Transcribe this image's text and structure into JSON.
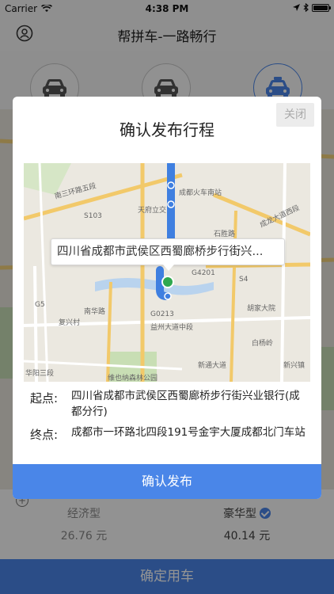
{
  "status_bar": {
    "carrier": "Carrier",
    "time": "4:38 PM"
  },
  "nav": {
    "title": "帮拼车-一路畅行"
  },
  "car_types": [
    {
      "icon": "car-icon",
      "selected": false
    },
    {
      "icon": "car-icon",
      "selected": false
    },
    {
      "icon": "taxi-icon",
      "selected": true
    }
  ],
  "estimate": {
    "options": [
      {
        "name": "经济型",
        "price": "26.76 元",
        "selected": false
      },
      {
        "name": "豪华型",
        "price": "40.14 元",
        "selected": true
      }
    ]
  },
  "confirm_bar": {
    "label": "确定用车"
  },
  "modal": {
    "close_label": "关闭",
    "title": "确认发布行程",
    "tooltip": "四川省成都市武侯区西蜀廊桥步行街兴...",
    "start_label": "起点:",
    "start_address": "四川省成都市武侯区西蜀廊桥步行街兴业银行(成都分行)",
    "end_label": "终点:",
    "end_address": "成都市一环路北四段191号金宇大厦成都北门车站",
    "confirm_label": "确认发布"
  },
  "map": {
    "labels": [
      "南三环路五段",
      "成都火车南站",
      "天府立交",
      "石胜路",
      "成龙大道西段",
      "益州大道中段",
      "复兴村",
      "胡家大院",
      "新通大道",
      "白杨岭",
      "维也纳森林公园",
      "新兴镇",
      "华阳三段",
      "南华路",
      "S103",
      "S4",
      "G4201",
      "G5",
      "G0213"
    ]
  },
  "colors": {
    "accent": "#4a86e8",
    "route": "#3f7fe0"
  }
}
